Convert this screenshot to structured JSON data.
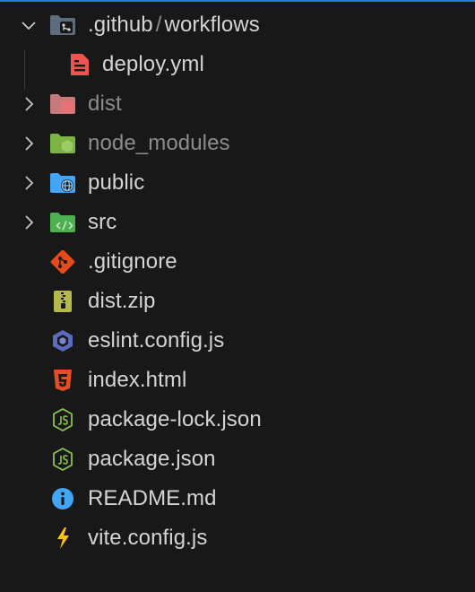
{
  "explorer": {
    "items": [
      {
        "name": ".github",
        "name2": "workflows",
        "sep": "/",
        "icon": "folder-github-icon",
        "expanded": true,
        "dim": false
      },
      {
        "name": "deploy.yml",
        "icon": "yaml-file-icon",
        "child": true
      },
      {
        "name": "dist",
        "icon": "folder-dist-icon",
        "expanded": false,
        "dim": true
      },
      {
        "name": "node_modules",
        "icon": "folder-node-icon",
        "expanded": false,
        "dim": true
      },
      {
        "name": "public",
        "icon": "folder-public-icon",
        "expanded": false
      },
      {
        "name": "src",
        "icon": "folder-src-icon",
        "expanded": false
      },
      {
        "name": ".gitignore",
        "icon": "git-icon"
      },
      {
        "name": "dist.zip",
        "icon": "zip-icon"
      },
      {
        "name": "eslint.config.js",
        "icon": "eslint-icon"
      },
      {
        "name": "index.html",
        "icon": "html5-icon"
      },
      {
        "name": "package-lock.json",
        "icon": "nodejs-icon"
      },
      {
        "name": "package.json",
        "icon": "nodejs-icon"
      },
      {
        "name": "README.md",
        "icon": "info-icon"
      },
      {
        "name": "vite.config.js",
        "icon": "vite-icon"
      }
    ]
  },
  "colors": {
    "background": "#181818",
    "accent": "#2b79d6",
    "text": "#d4d4d4",
    "dim_text": "#8c8c8c"
  }
}
